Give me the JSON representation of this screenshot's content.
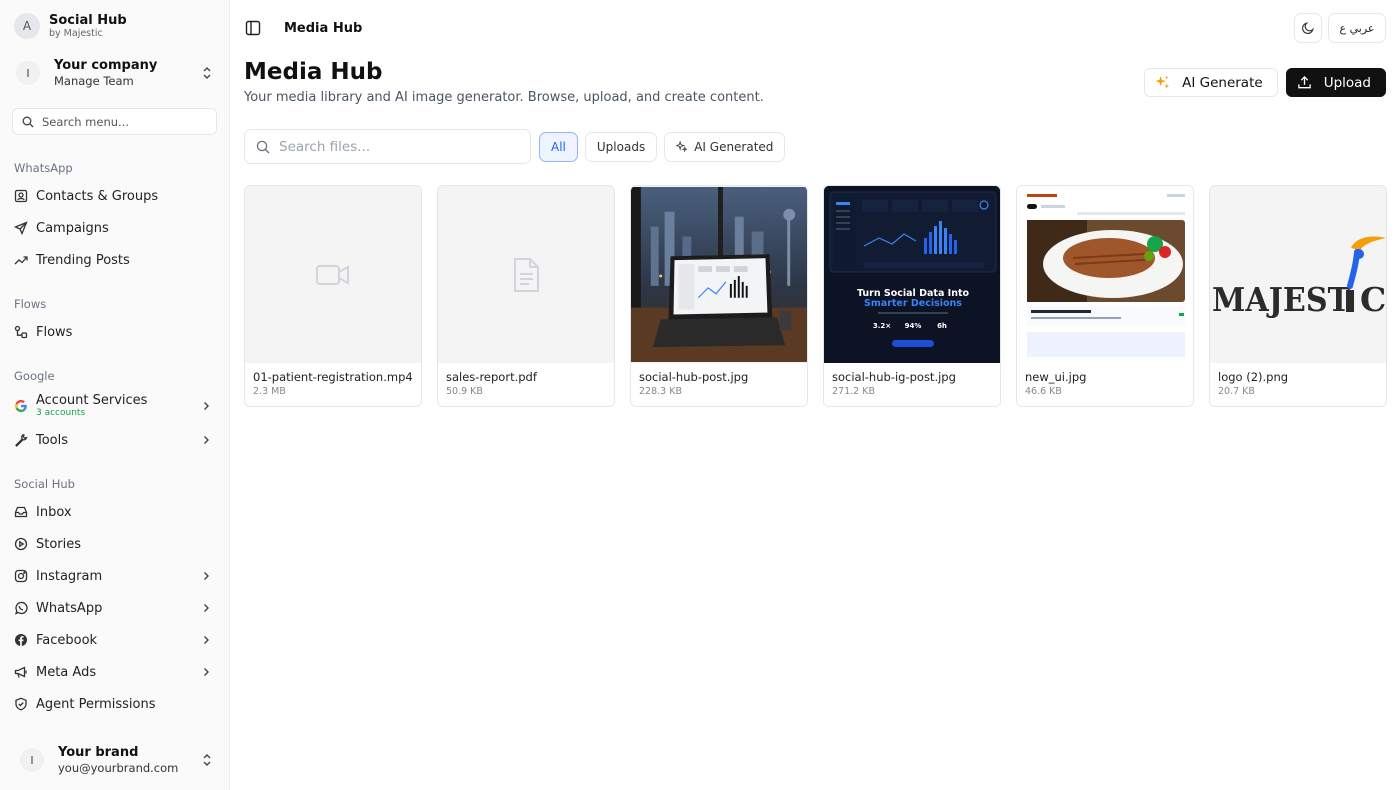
{
  "sidebar": {
    "brand": {
      "avatar": "A",
      "title": "Social Hub",
      "subtitle": "by Majestic"
    },
    "team": {
      "avatar": "I",
      "title": "Your company",
      "subtitle": "Manage Team"
    },
    "search_placeholder": "Search menu...",
    "sections": {
      "whatsapp": {
        "label": "WhatsApp",
        "items": [
          {
            "label": "Contacts & Groups",
            "icon": "contacts-icon"
          },
          {
            "label": "Campaigns",
            "icon": "send-icon"
          },
          {
            "label": "Trending Posts",
            "icon": "trending-up-icon"
          }
        ]
      },
      "flows": {
        "label": "Flows",
        "items": [
          {
            "label": "Flows",
            "icon": "workflow-icon"
          }
        ]
      },
      "google": {
        "label": "Google",
        "account_services": {
          "label": "Account Services",
          "sub": "3 accounts",
          "icon": "google-icon"
        },
        "tools": {
          "label": "Tools",
          "icon": "wrench-icon"
        }
      },
      "social_hub": {
        "label": "Social Hub",
        "items": [
          {
            "label": "Inbox",
            "icon": "inbox-icon"
          },
          {
            "label": "Stories",
            "icon": "play-circle-icon"
          },
          {
            "label": "Instagram",
            "icon": "instagram-icon"
          },
          {
            "label": "WhatsApp",
            "icon": "whatsapp-icon"
          },
          {
            "label": "Facebook",
            "icon": "facebook-icon"
          },
          {
            "label": "Meta Ads",
            "icon": "megaphone-icon"
          },
          {
            "label": "Agent Permissions",
            "icon": "shield-icon"
          }
        ]
      }
    },
    "footer": {
      "avatar": "I",
      "title": "Your brand",
      "subtitle": "you@yourbrand.com"
    }
  },
  "topbar": {
    "breadcrumb": "Media Hub",
    "lang_label": "عربي ع"
  },
  "header": {
    "title": "Media Hub",
    "subtitle": "Your media library and AI image generator. Browse, upload, and create content.",
    "ai_generate_label": "AI Generate",
    "upload_label": "Upload"
  },
  "filters": {
    "search_placeholder": "Search files...",
    "tabs": [
      {
        "label": "All",
        "active": true
      },
      {
        "label": "Uploads",
        "active": false
      },
      {
        "label": "AI Generated",
        "active": false
      }
    ]
  },
  "files": [
    {
      "name": "01-patient-registration.mp4",
      "size": "2.3 MB",
      "kind": "video"
    },
    {
      "name": "sales-report.pdf",
      "size": "50.9 KB",
      "kind": "document"
    },
    {
      "name": "social-hub-post.jpg",
      "size": "228.3 KB",
      "kind": "image"
    },
    {
      "name": "social-hub-ig-post.jpg",
      "size": "271.2 KB",
      "kind": "image"
    },
    {
      "name": "new_ui.jpg",
      "size": "46.6 KB",
      "kind": "image"
    },
    {
      "name": "logo (2).png",
      "size": "20.7 KB",
      "kind": "image"
    }
  ],
  "thumb_text": {
    "ig_post_line1": "Turn Social Data Into",
    "ig_post_line2": "Smarter Decisions",
    "ig_stats": [
      "3.2×",
      "94%",
      "6h"
    ],
    "logo_text": "MAJEST",
    "logo_text2": "C"
  },
  "colors": {
    "accent_blue": "#2563eb",
    "success_green": "#16a34a",
    "dark_button": "#111111",
    "ai_star": "#f59e0b"
  }
}
